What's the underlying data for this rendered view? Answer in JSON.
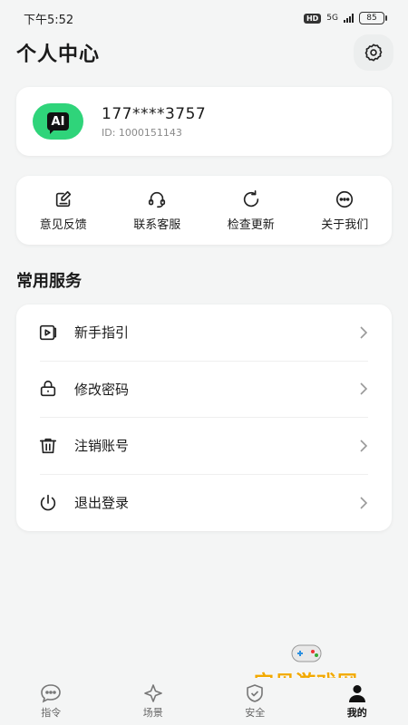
{
  "status_bar": {
    "time": "下午5:52",
    "hd": "HD",
    "network": "5G",
    "battery": "85"
  },
  "header": {
    "title": "个人中心",
    "settings_icon": "gear-icon"
  },
  "profile": {
    "avatar_text": "AI",
    "avatar_color": "#2fd47a",
    "phone": "177****3757",
    "id_text": "ID: 1000151143"
  },
  "quick_actions": [
    {
      "label": "意见反馈",
      "icon": "feedback-icon"
    },
    {
      "label": "联系客服",
      "icon": "headset-icon"
    },
    {
      "label": "检查更新",
      "icon": "refresh-icon"
    },
    {
      "label": "关于我们",
      "icon": "more-dots-icon"
    }
  ],
  "services": {
    "title": "常用服务",
    "items": [
      {
        "label": "新手指引",
        "icon": "video-guide-icon"
      },
      {
        "label": "修改密码",
        "icon": "lock-icon"
      },
      {
        "label": "注销账号",
        "icon": "trash-icon"
      },
      {
        "label": "退出登录",
        "icon": "power-icon"
      }
    ]
  },
  "tabbar": {
    "tabs": [
      {
        "label": "指令",
        "icon": "chat-bubble-icon"
      },
      {
        "label": "场景",
        "icon": "sparkle-icon"
      },
      {
        "label": "安全",
        "icon": "shield-icon"
      },
      {
        "label": "我的",
        "icon": "person-icon",
        "active": true
      }
    ]
  },
  "watermark": {
    "text": "宝贝游戏网",
    "url": "baobeiy.com"
  }
}
